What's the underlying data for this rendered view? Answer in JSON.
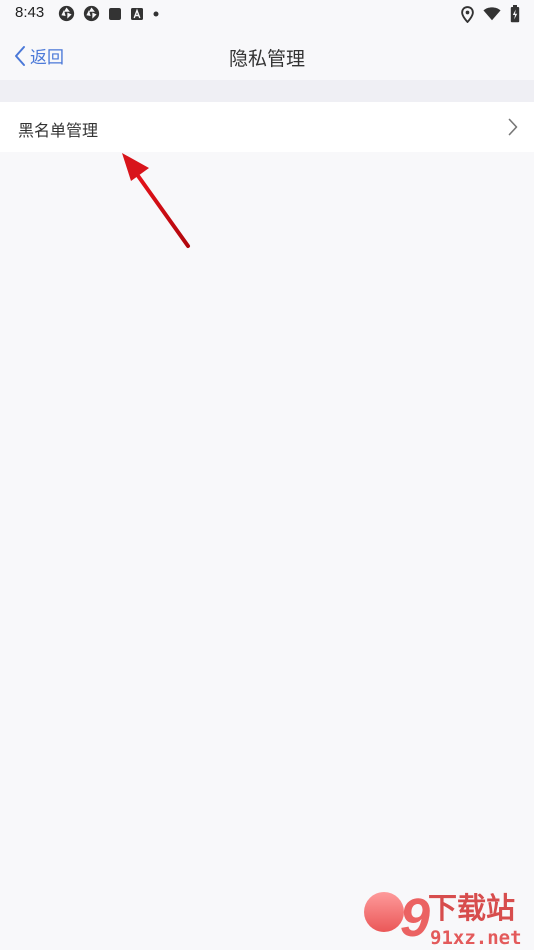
{
  "status_bar": {
    "time": "8:43",
    "left_icons": [
      "aperture-icon",
      "aperture-icon",
      "square-icon",
      "a-box-icon",
      "dot-icon"
    ],
    "right_icons": [
      "location-icon",
      "wifi-icon",
      "battery-charging-icon"
    ]
  },
  "nav": {
    "back_label": "返回",
    "title": "隐私管理"
  },
  "list": {
    "items": [
      {
        "label": "黑名单管理"
      }
    ]
  },
  "watermark": {
    "logo_text": "9",
    "title": "下载站",
    "site": "91xz.net"
  },
  "colors": {
    "accent": "#4a78d8",
    "background": "#f8f8fa",
    "section_band": "#efeff4",
    "row_background": "#ffffff",
    "annotation_arrow": "#d8141b"
  }
}
